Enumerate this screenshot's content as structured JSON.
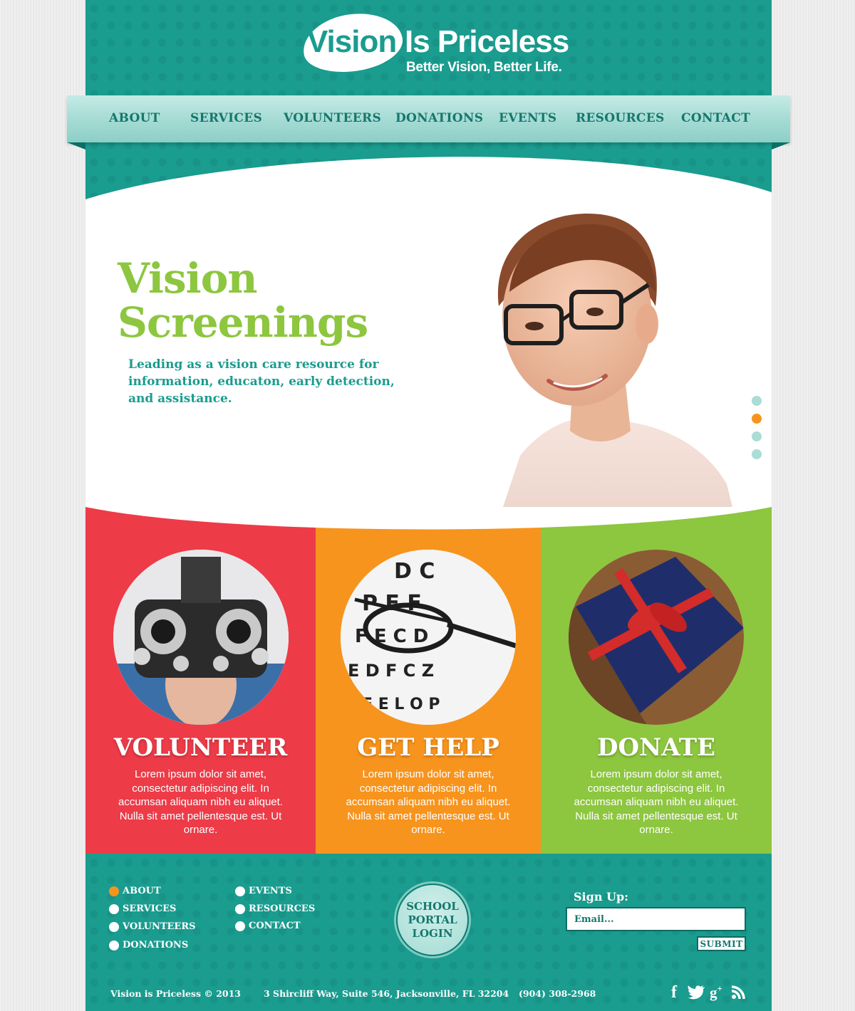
{
  "brand": {
    "logo_word1": "Vision",
    "logo_word2": "Is Priceless",
    "tagline": "Better Vision, Better Life."
  },
  "nav": {
    "items": [
      {
        "label": "ABOUT"
      },
      {
        "label": "SERVICES"
      },
      {
        "label": "VOLUNTEERS"
      },
      {
        "label": "DONATIONS"
      },
      {
        "label": "EVENTS"
      },
      {
        "label": "RESOURCES"
      },
      {
        "label": "CONTACT"
      }
    ]
  },
  "hero": {
    "title_line1": "Vision",
    "title_line2": "Screenings",
    "subtitle": "Leading as a vision care resource for information, educaton, early detection, and assistance.",
    "slide_active_index": 1,
    "slide_count": 4
  },
  "panels": [
    {
      "title": "VOLUNTEER",
      "text": "Lorem ipsum dolor sit amet, consectetur adipiscing elit. In accumsan aliquam nibh eu aliquet. Nulla sit amet pellentesque est. Ut ornare.",
      "color": "#ed3b48"
    },
    {
      "title": "GET HELP",
      "text": "Lorem ipsum dolor sit amet, consectetur adipiscing elit. In accumsan aliquam nibh eu aliquet. Nulla sit amet pellentesque est. Ut ornare.",
      "color": "#f7941d"
    },
    {
      "title": "DONATE",
      "text": "Lorem ipsum dolor sit amet, consectetur adipiscing elit. In accumsan aliquam nibh eu aliquet. Nulla sit amet pellentesque est. Ut ornare.",
      "color": "#8dc63f"
    }
  ],
  "footer": {
    "links_col1": [
      "ABOUT",
      "SERVICES",
      "VOLUNTEERS",
      "DONATIONS"
    ],
    "links_col2": [
      "EVENTS",
      "RESOURCES",
      "CONTACT"
    ],
    "portal_label": "SCHOOL PORTAL LOGIN",
    "signup_label": "Sign Up:",
    "email_placeholder": "Email...",
    "submit_label": "SUBMIT",
    "copyright": "Vision is Priceless © 2013",
    "address": "3 Shircliff Way, Suite 546, Jacksonville, FL 32204",
    "phone": "(904) 308-2968",
    "social": [
      "facebook-icon",
      "twitter-icon",
      "google-plus-icon",
      "rss-icon"
    ]
  },
  "colors": {
    "teal": "#1a9c8f",
    "green": "#8dc63f",
    "orange": "#f7941d",
    "red": "#ed3b48"
  }
}
